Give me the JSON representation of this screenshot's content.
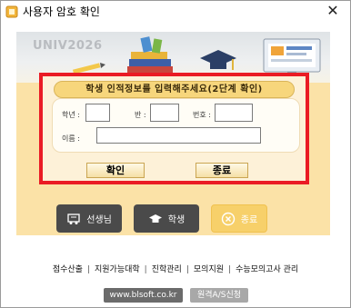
{
  "window": {
    "title": "사용자 암호 확인",
    "close_glyph": "✕"
  },
  "banner": {
    "watermark": "UNIV2026"
  },
  "dialog": {
    "header": "학생 인적정보를 입력해주세요(2단계 확인)",
    "grade_label": "학년 :",
    "class_label": "반 :",
    "number_label": "번호 :",
    "name_label": "이름 :",
    "grade_value": "",
    "class_value": "",
    "number_value": "",
    "name_value": "",
    "ok_label": "확인",
    "exit_label": "종료"
  },
  "roles": {
    "teacher_label": "선생님",
    "student_label": "학생",
    "exit_label": "종료"
  },
  "menu": {
    "items": [
      "점수산출",
      "지원가능대학",
      "진학관리",
      "모의지원",
      "수능모의고사 관리"
    ],
    "separator": "|"
  },
  "footer": {
    "url_label": "www.blsoft.co.kr",
    "remote_label": "원격A/S신청"
  },
  "colors": {
    "highlight_border": "#ea1b24",
    "cream_bg": "#fbe2a7",
    "dark_button": "#4a4a4a",
    "exit_button": "#f7d06a"
  }
}
